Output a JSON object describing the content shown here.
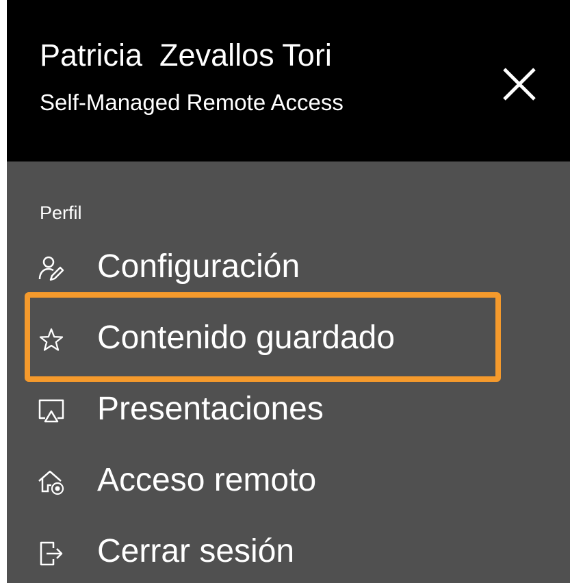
{
  "header": {
    "name": "Patricia  Zevallos Tori",
    "subtitle": "Self-Managed Remote Access",
    "close_icon": "close-icon"
  },
  "menu": {
    "section_label": "Perfil",
    "items": [
      {
        "label": "Configuración",
        "icon": "user-edit-icon"
      },
      {
        "label": "Contenido guardado",
        "icon": "star-icon",
        "highlighted": true
      },
      {
        "label": "Presentaciones",
        "icon": "presentation-icon"
      },
      {
        "label": "Acceso remoto",
        "icon": "remote-home-icon"
      },
      {
        "label": "Cerrar sesión",
        "icon": "logout-icon"
      }
    ]
  },
  "colors": {
    "header_bg": "#000000",
    "panel_bg": "#505050",
    "text": "#ffffff",
    "highlight": "#f59a2c"
  }
}
